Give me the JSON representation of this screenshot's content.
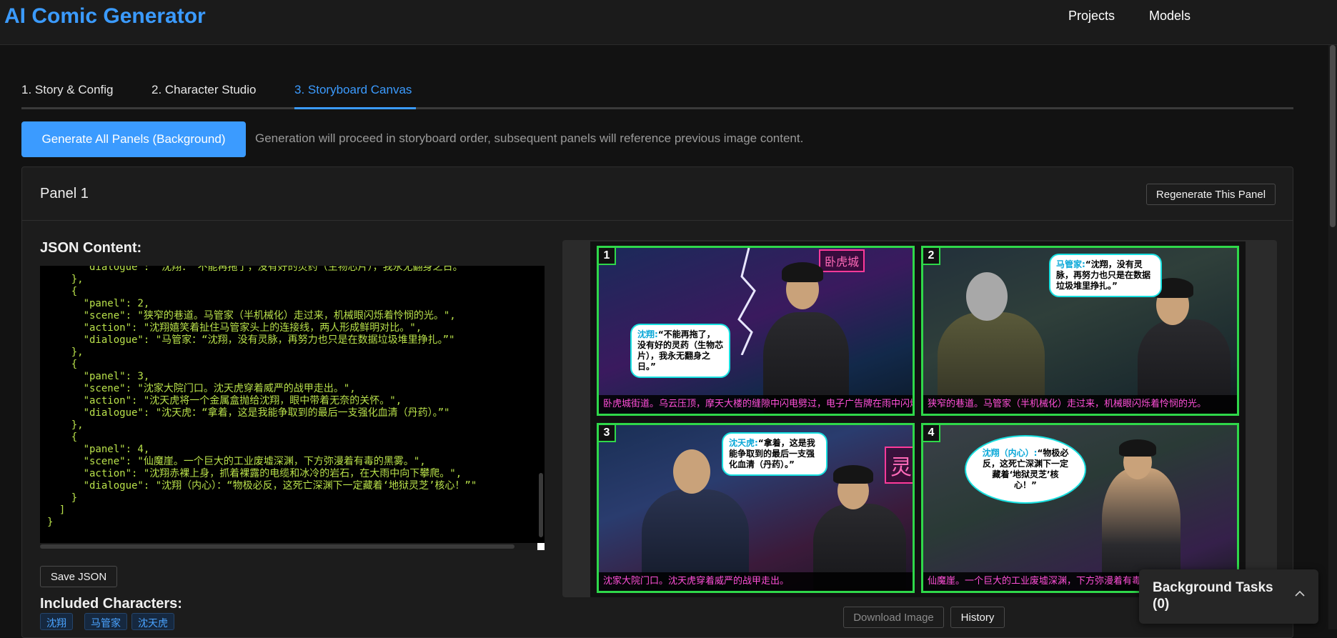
{
  "app": {
    "title": "AI Comic Generator"
  },
  "nav": {
    "projects": "Projects",
    "models": "Models"
  },
  "tabs": [
    {
      "label": "1. Story & Config"
    },
    {
      "label": "2. Character Studio"
    },
    {
      "label": "3. Storyboard Canvas"
    }
  ],
  "actions": {
    "generate_all": "Generate All Panels (Background)",
    "generate_note": "Generation will proceed in storyboard order, subsequent panels will reference previous image content."
  },
  "panel": {
    "title": "Panel 1",
    "regenerate": "Regenerate This Panel",
    "json_label": "JSON Content:",
    "json_text": "      \"dialogue\": \"沈翔：“不能再拖了，没有好的灵药（生物芯片），我永无翻身之日。”\"\n    },\n    {\n      \"panel\": 2,\n      \"scene\": \"狭窄的巷道。马管家（半机械化）走过来，机械眼闪烁着怜悯的光。\",\n      \"action\": \"沈翔嬉笑着扯住马管家头上的连接线，两人形成鲜明对比。\",\n      \"dialogue\": \"马管家：“沈翔，没有灵脉，再努力也只是在数据垃圾堆里挣扎。”\"\n    },\n    {\n      \"panel\": 3,\n      \"scene\": \"沈家大院门口。沈天虎穿着威严的战甲走出。\",\n      \"action\": \"沈天虎将一个金属盒抛给沈翔，眼中带着无奈的关怀。\",\n      \"dialogue\": \"沈天虎：“拿着，这是我能争取到的最后一支强化血清（丹药）。”\"\n    },\n    {\n      \"panel\": 4,\n      \"scene\": \"仙魔崖。一个巨大的工业废墟深渊，下方弥漫着有毒的黑雾。\",\n      \"action\": \"沈翔赤裸上身，抓着裸露的电缆和冰冷的岩石，在大雨中向下攀爬。\",\n      \"dialogue\": \"沈翔（内心）：“物极必反，这死亡深渊下一定藏着‘地狱灵芝’核心！”\"\n    }\n  ]\n}",
    "save_json": "Save JSON",
    "characters_label": "Included Characters:",
    "characters": [
      "沈翔",
      "马管家",
      "沈天虎"
    ]
  },
  "comic": {
    "panels": [
      {
        "num": "1",
        "sign": "卧虎城",
        "caption": "卧虎城街道。乌云压顶，摩天大楼的缝隙中闪电劈过，电子广告牌在雨中闪烁。",
        "speaker": "沈翔:",
        "bubble": "“不能再拖了，没有好的灵药（生物芯片），我永无翻身之日。”"
      },
      {
        "num": "2",
        "caption": "狭窄的巷道。马管家（半机械化）走过来，机械眼闪烁着怜悯的光。",
        "speaker": "马管家:",
        "bubble": "“沈翔，没有灵脉，再努力也只是在数据垃圾堆里挣扎。”"
      },
      {
        "num": "3",
        "sign": "灵",
        "caption": "沈家大院门口。沈天虎穿着威严的战甲走出。",
        "speaker": "沈天虎:",
        "bubble": "“拿着，这是我能争取到的最后一支强化血清（丹药）。”"
      },
      {
        "num": "4",
        "caption": "仙魔崖。一个巨大的工业废墟深渊，下方弥漫着有毒",
        "speaker": "沈翔（内心）:",
        "bubble": "“物极必反，这死亡深渊下一定藏着‘地狱灵芝’核心！”"
      }
    ]
  },
  "image_actions": {
    "download": "Download Image",
    "history": "History"
  },
  "background_tasks": {
    "label": "Background Tasks (0)"
  },
  "colors": {
    "accent": "#3b9bff",
    "panel_border": "#2fd84a",
    "caption": "#ff4fd8",
    "json_text": "#b8e04a"
  }
}
